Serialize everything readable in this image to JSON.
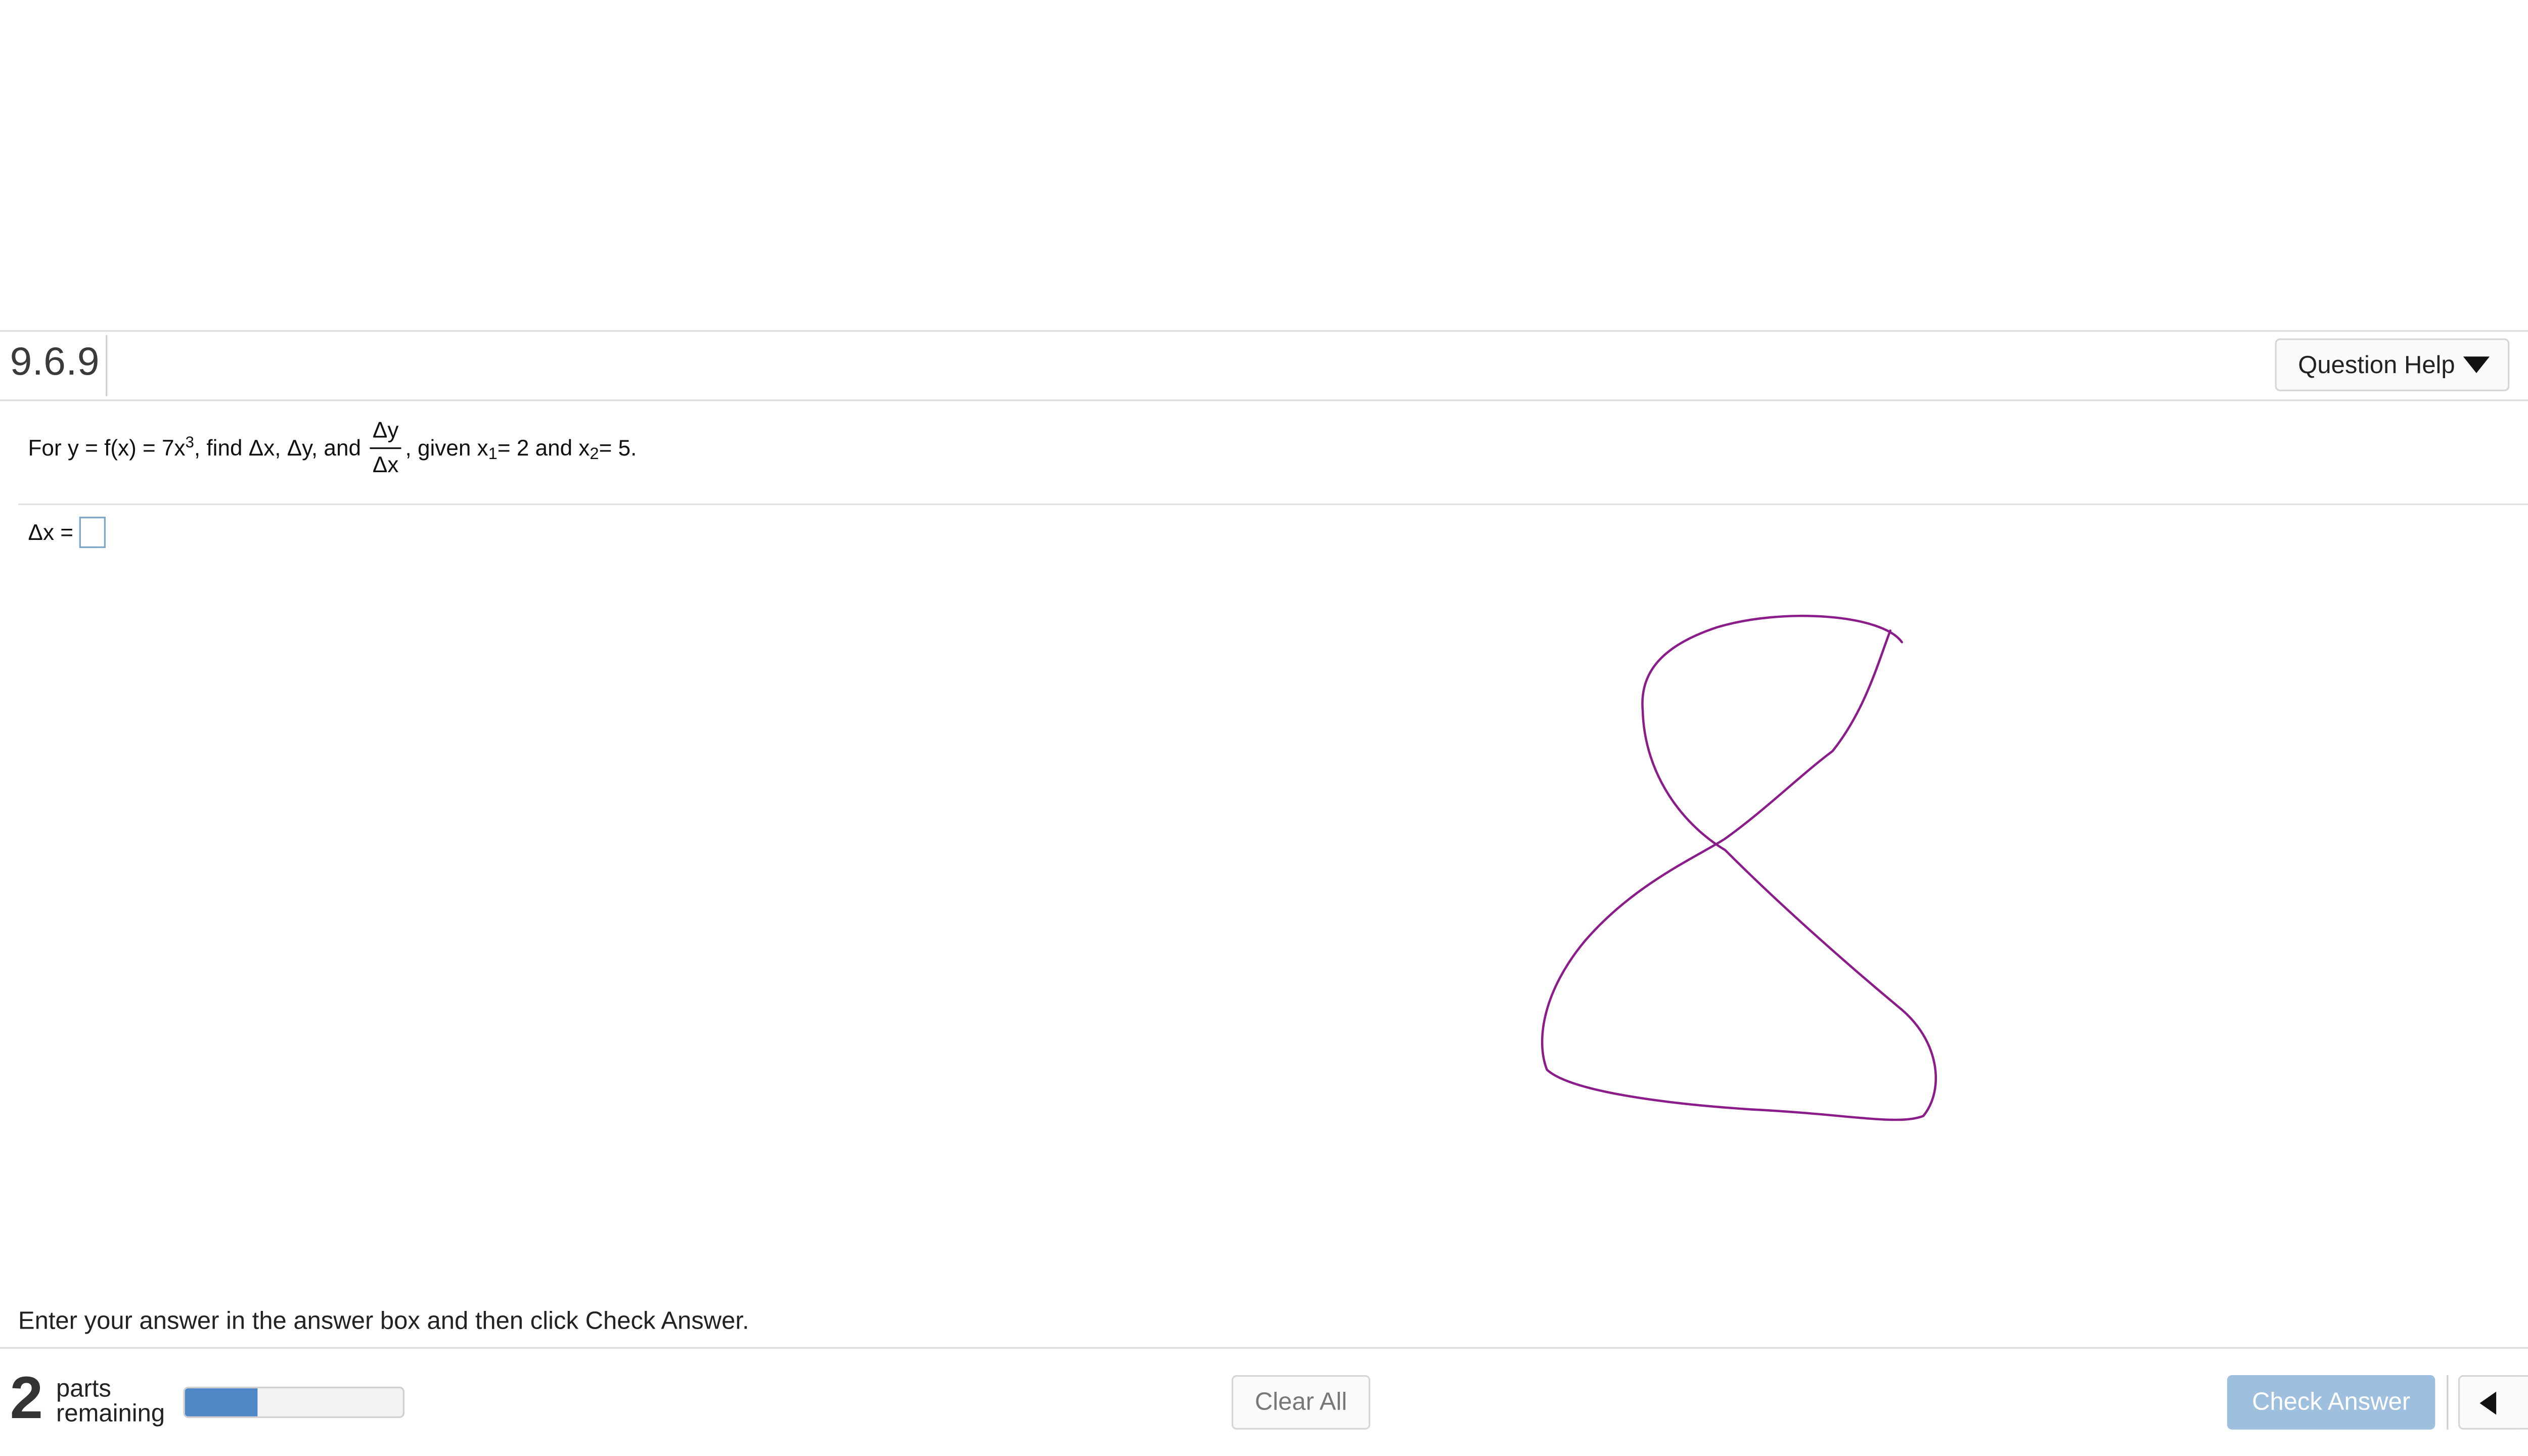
{
  "header": {
    "question_number": "9.6.9",
    "question_help_label": "Question Help"
  },
  "problem": {
    "intro": "For y = f(x) = 7x",
    "exponent": "3",
    "find_text": ", find Δx, Δy, and",
    "fraction_numerator": "Δy",
    "fraction_denominator": "Δx",
    "given_text": ", given x",
    "x1_sub": "1",
    "x1_value": " = 2 and x",
    "x2_sub": "2",
    "x2_value": " = 5."
  },
  "answer": {
    "label": "Δx ="
  },
  "footer": {
    "instruction": "Enter your answer in the answer box and then click Check Answer.",
    "help_symbol": "?",
    "parts_count": "2",
    "parts_label_line1": "parts",
    "parts_label_line2": "remaining",
    "progress_fraction": 0.33,
    "clear_all_label": "Clear All",
    "check_answer_label": "Check Answer"
  },
  "colors": {
    "drawing_stroke": "#8a1d8a",
    "progress_fill": "#4f86c6",
    "check_button": "#9fbfde"
  },
  "icons": [
    "gear-icon",
    "dropdown-triangle-icon",
    "help-icon",
    "previous-arrow-icon",
    "next-arrow-icon"
  ]
}
